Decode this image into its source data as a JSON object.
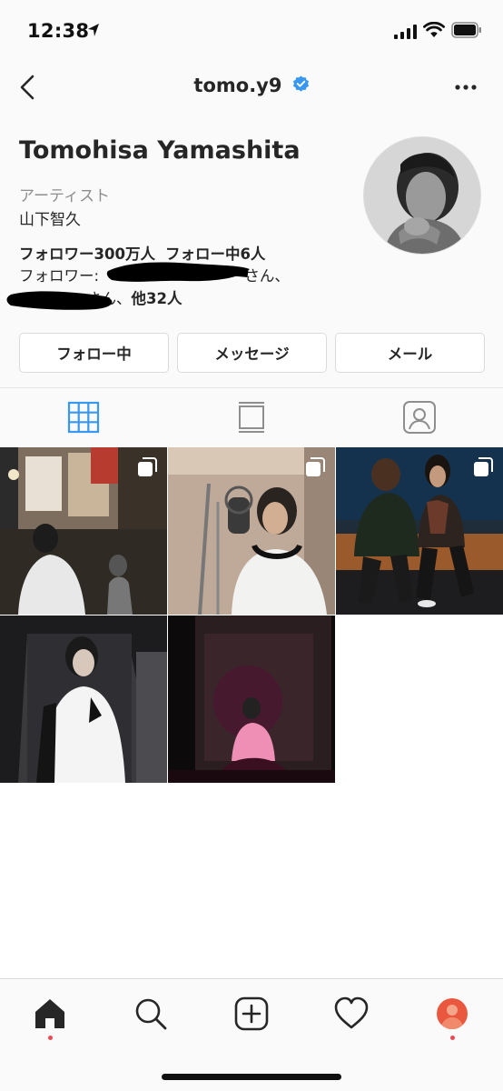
{
  "status_bar": {
    "time": "12:38",
    "icons": [
      "location-arrow-icon",
      "signal-bars-icon",
      "wifi-icon",
      "battery-icon"
    ]
  },
  "header": {
    "username": "tomo.y9",
    "back_icon": "chevron-left-icon",
    "verified_icon": "verified-badge-icon",
    "more_icon": "more-dots-icon"
  },
  "profile": {
    "full_name": "Tomohisa Yamashita",
    "category": "アーティスト",
    "bio": "山下智久",
    "followers": "フォロワー300万人",
    "following": "フォロー中6人",
    "followed_by_prefix": "フォロワー: ",
    "followed_by_mid": "さん、",
    "followed_by_suffix": "さん、",
    "followed_by_others": "他32人"
  },
  "actions": {
    "following": "フォロー中",
    "message": "メッセージ",
    "email": "メール"
  },
  "tabs": [
    {
      "icon": "grid-icon",
      "active": true
    },
    {
      "icon": "feed-icon",
      "active": false
    },
    {
      "icon": "tagged-person-icon",
      "active": false
    }
  ],
  "posts": [
    {
      "multiple": true
    },
    {
      "multiple": true
    },
    {
      "multiple": true
    },
    {
      "multiple": false
    },
    {
      "multiple": false
    }
  ],
  "bottom_nav": [
    {
      "icon": "home-icon",
      "active": true,
      "notification_dot": true
    },
    {
      "icon": "search-icon",
      "active": false
    },
    {
      "icon": "new-post-icon",
      "active": false
    },
    {
      "icon": "heart-icon",
      "active": false
    },
    {
      "icon": "profile-avatar-icon",
      "active": false,
      "notification_dot": true
    }
  ],
  "colors": {
    "accent_blue": "#3897f0",
    "notification_red": "#ed4956",
    "text": "#262626",
    "secondary_text": "#8e8e8e",
    "border": "#dbdbdb"
  }
}
